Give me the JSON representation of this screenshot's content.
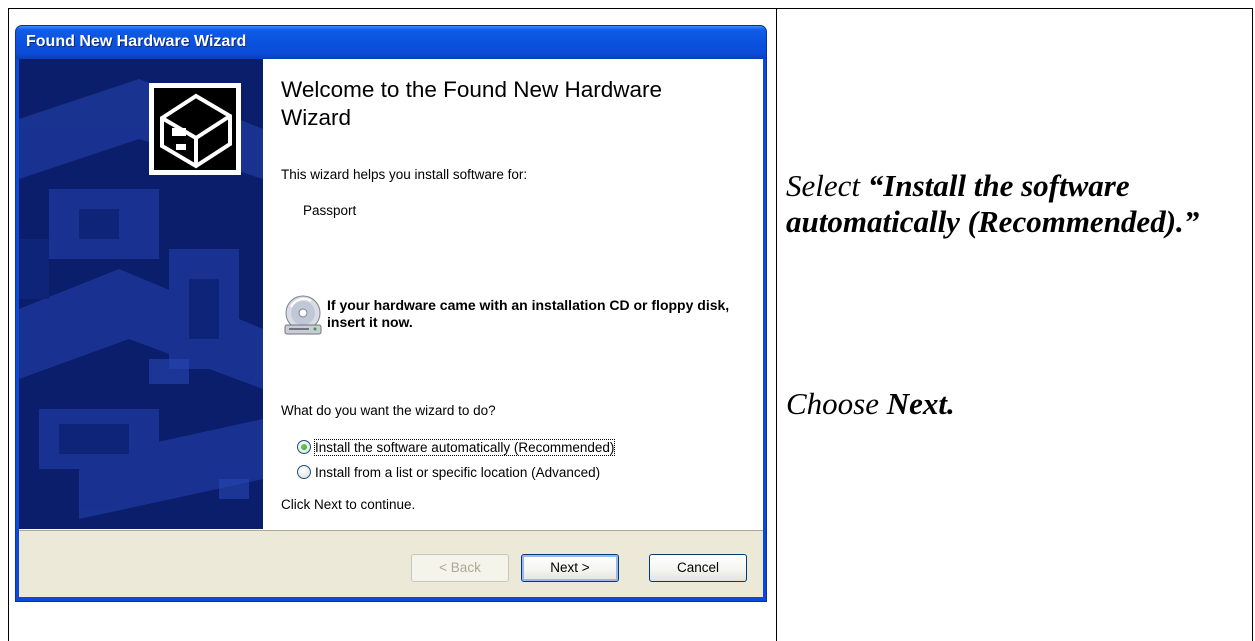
{
  "wizard": {
    "title": "Found New Hardware Wizard",
    "heading": "Welcome to the Found New Hardware Wizard",
    "intro": "This wizard helps you install software for:",
    "device_name": "Passport",
    "cd_notice": "If your hardware came with an installation CD or floppy disk, insert it now.",
    "question": "What do you want the wizard to do?",
    "options": [
      {
        "label": "Install the software automatically (Recommended)",
        "selected": true
      },
      {
        "label": "Install from a list or specific location (Advanced)",
        "selected": false
      }
    ],
    "continue_hint": "Click Next to continue.",
    "buttons": {
      "back": "< Back",
      "next": "Next >",
      "cancel": "Cancel"
    },
    "icons": [
      "hardware-icon",
      "cd-drive-icon"
    ]
  },
  "instructions": {
    "step1_prefix": "Select ",
    "step1_bold": "“Install the software automatically (Recommended).”",
    "step2_prefix": "Choose ",
    "step2_bold": "Next."
  }
}
